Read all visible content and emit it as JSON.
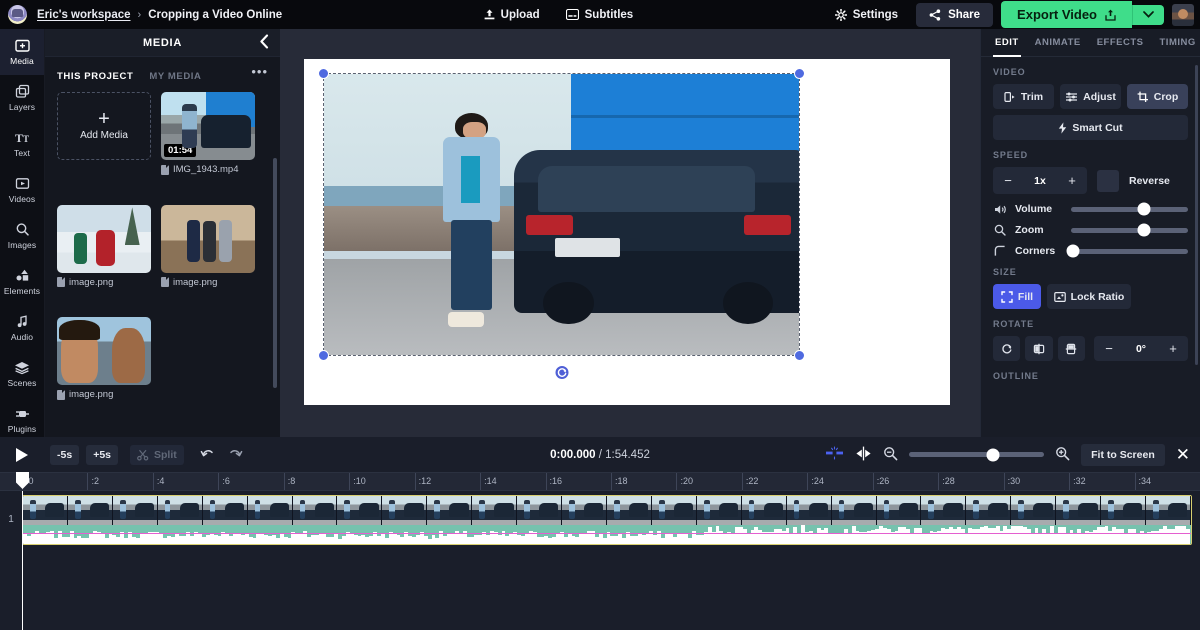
{
  "topbar": {
    "workspace": "Eric's workspace",
    "separator": "›",
    "project": "Cropping a Video Online",
    "upload": "Upload",
    "subtitles": "Subtitles",
    "settings": "Settings",
    "share": "Share",
    "export": "Export Video",
    "export_caret": "⌄"
  },
  "rail": {
    "items": [
      {
        "label": "Media",
        "icon": "media-icon",
        "active": true
      },
      {
        "label": "Layers",
        "icon": "layers-icon",
        "active": false
      },
      {
        "label": "Text",
        "icon": "text-icon",
        "active": false
      },
      {
        "label": "Videos",
        "icon": "videos-icon",
        "active": false
      },
      {
        "label": "Images",
        "icon": "images-icon",
        "active": false
      },
      {
        "label": "Elements",
        "icon": "elements-icon",
        "active": false
      },
      {
        "label": "Audio",
        "icon": "audio-icon",
        "active": false
      },
      {
        "label": "Scenes",
        "icon": "scenes-icon",
        "active": false
      },
      {
        "label": "Plugins",
        "icon": "plugins-icon",
        "active": false
      }
    ]
  },
  "media_panel": {
    "title": "MEDIA",
    "collapse_icon": "chevron-left-icon",
    "more_icon": "more-options-icon",
    "tabs": [
      {
        "label": "THIS PROJECT",
        "active": true
      },
      {
        "label": "MY MEDIA",
        "active": false
      }
    ],
    "add_media": {
      "plus": "+",
      "label": "Add Media"
    },
    "items": [
      {
        "name": "IMG_1943.mp4",
        "duration": "01:54",
        "kind": "video"
      },
      {
        "name": "image.png",
        "duration": "",
        "kind": "image"
      },
      {
        "name": "image.png",
        "duration": "",
        "kind": "image"
      },
      {
        "name": "image.png",
        "duration": "",
        "kind": "image"
      }
    ]
  },
  "right_panel": {
    "tabs": [
      {
        "label": "EDIT",
        "active": true
      },
      {
        "label": "ANIMATE",
        "active": false
      },
      {
        "label": "EFFECTS",
        "active": false
      },
      {
        "label": "TIMING",
        "active": false
      }
    ],
    "video": {
      "section": "VIDEO",
      "trim": "Trim",
      "adjust": "Adjust",
      "crop": "Crop",
      "smart_cut": "Smart Cut"
    },
    "speed": {
      "section": "SPEED",
      "minus": "−",
      "value": "1x",
      "plus": "+",
      "reverse": "Reverse",
      "reverse_checked": false
    },
    "sliders": [
      {
        "label": "Volume",
        "icon": "volume-icon",
        "percent": 62
      },
      {
        "label": "Zoom",
        "icon": "zoom-icon",
        "percent": 62
      },
      {
        "label": "Corners",
        "icon": "corners-icon",
        "percent": 2
      }
    ],
    "size": {
      "section": "SIZE",
      "fill": "Fill",
      "lock_ratio": "Lock Ratio"
    },
    "rotate": {
      "section": "ROTATE",
      "reset_icon": "rotate-reset-icon",
      "flip_h_icon": "flip-horizontal-icon",
      "flip_v_icon": "flip-vertical-icon",
      "minus": "−",
      "value": "0°",
      "plus": "+"
    },
    "outline": {
      "section": "OUTLINE"
    }
  },
  "timeline": {
    "play_icon": "play-icon",
    "back_5s": "-5s",
    "fwd_5s": "+5s",
    "split": "Split",
    "split_icon": "scissors-icon",
    "undo_icon": "undo-icon",
    "redo_icon": "redo-icon",
    "current_time": "0:00.000",
    "time_divider": " / ",
    "total_time": "1:54.452",
    "magnet_icon": "snap-icon",
    "marker_icon": "marker-icon",
    "zoom_out_icon": "zoom-out-icon",
    "zoom_in_icon": "zoom-in-icon",
    "zoom_percent": 62,
    "fit_to_screen": "Fit to Screen",
    "close_icon": "close-icon",
    "track_number": "1",
    "ruler_ticks": [
      ":0",
      ":2",
      ":4",
      ":6",
      ":8",
      ":10",
      ":12",
      ":14",
      ":16",
      ":18",
      ":20",
      ":22",
      ":24",
      ":26",
      ":28",
      ":30",
      ":32",
      ":34"
    ]
  },
  "colors": {
    "accent_green": "#3fdd8a",
    "accent_blue": "#4b5ae8",
    "handle_blue": "#4f6ae0",
    "clip_border": "#d8cf70",
    "audio_teal": "#76c2ae"
  }
}
